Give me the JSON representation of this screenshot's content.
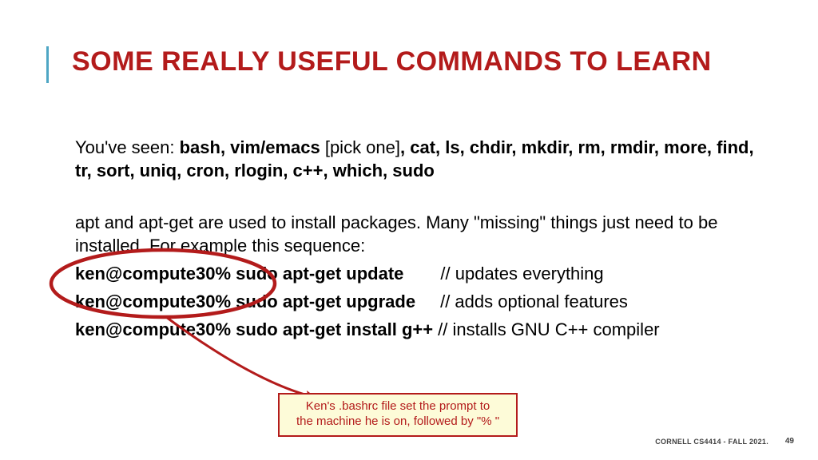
{
  "colors": {
    "accent_red": "#b31b1b",
    "accent_blue": "#4ea6c4",
    "callout_bg": "#fdfbd8"
  },
  "title": "SOME REALLY USEFUL COMMANDS TO LEARN",
  "para1": {
    "lead": "You've seen: ",
    "bold1": "bash, vim/emacs ",
    "plain1": "[pick one]",
    "bold2": ", cat, ls, chdir, mkdir, rm, rmdir, more, find, tr, sort, uniq, cron, rlogin, c++, which, sudo"
  },
  "para2": "apt and apt-get are used to install packages.  Many \"missing\" things just need to be installed.  For example this sequence:",
  "commands": [
    {
      "cmd": "ken@compute30% sudo apt-get update",
      "note": "// updates everything",
      "pad": "46px"
    },
    {
      "cmd": "ken@compute30% sudo apt-get upgrade",
      "note": "// adds optional features",
      "pad": "31px"
    },
    {
      "cmd": "ken@compute30% sudo apt-get install g++",
      "note": "// installs GNU C++ compiler",
      "pad": "6px"
    }
  ],
  "callout": {
    "line1": "Ken's .bashrc file set the prompt to",
    "line2": "the machine he is on, followed by \"% \""
  },
  "footer": {
    "course": "CORNELL CS4414 - FALL 2021.",
    "page": "49"
  }
}
